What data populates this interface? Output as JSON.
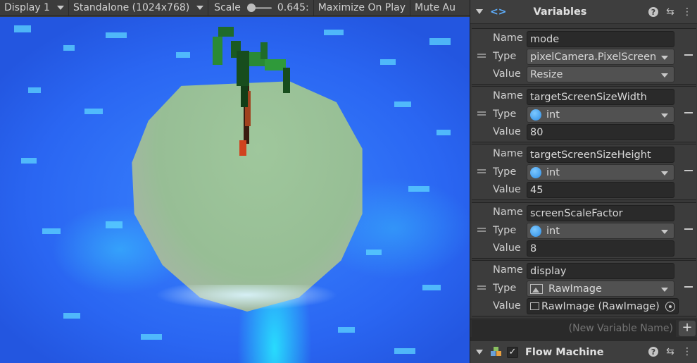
{
  "game_toolbar": {
    "display": "Display 1",
    "resolution": "Standalone (1024x768)",
    "scale_label": "Scale",
    "scale_value": "0.645:",
    "scale_fraction": 0.05,
    "maximize": "Maximize On Play",
    "mute": "Mute Au"
  },
  "variables_panel": {
    "title": "Variables",
    "field_labels": {
      "name": "Name",
      "type": "Type",
      "value": "Value"
    },
    "items": [
      {
        "name": "mode",
        "type": "pixelCamera.PixelScreen",
        "type_icon": "none",
        "value": "Resize",
        "value_kind": "dropdown"
      },
      {
        "name": "targetScreenSizeWidth",
        "type": "int",
        "type_icon": "int-icon",
        "value": "80",
        "value_kind": "text"
      },
      {
        "name": "targetScreenSizeHeight",
        "type": "int",
        "type_icon": "int-icon",
        "value": "45",
        "value_kind": "text"
      },
      {
        "name": "screenScaleFactor",
        "type": "int",
        "type_icon": "int-icon",
        "value": "8",
        "value_kind": "text"
      },
      {
        "name": "display",
        "type": "RawImage",
        "type_icon": "image-icon",
        "value": "RawImage (RawImage)",
        "value_kind": "object"
      }
    ],
    "new_variable_placeholder": "(New Variable Name)",
    "add_symbol": "+"
  },
  "flow_machine": {
    "title": "Flow Machine",
    "checkbox": "✓"
  },
  "icons": {
    "help": "?",
    "settings": "⇆",
    "menu": "⋮",
    "code": "<>"
  },
  "colors": {
    "inspector_bg": "#383838",
    "field_bg": "#2a2a2a",
    "int_icon": "#3f9ef0",
    "water": "#2a66f2",
    "island": "#97be95"
  }
}
